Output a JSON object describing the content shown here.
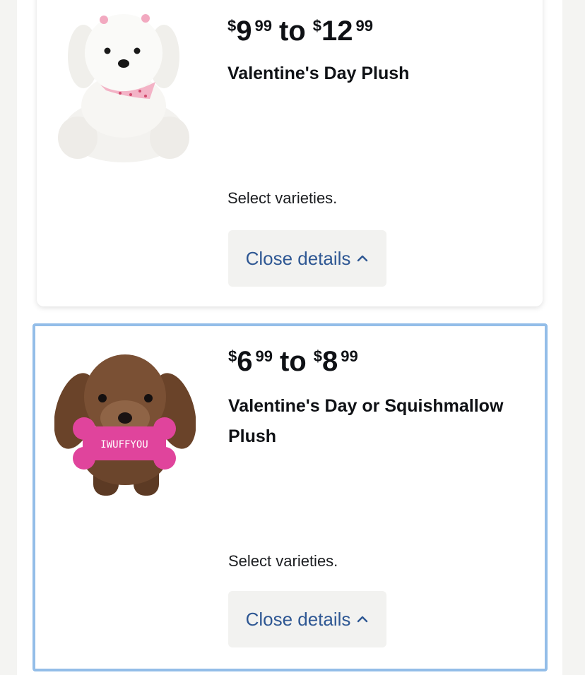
{
  "products": [
    {
      "price": {
        "from_currency": "$",
        "from_dollars": "9",
        "from_cents": "99",
        "to_word": "to",
        "to_currency": "$",
        "to_dollars": "12",
        "to_cents": "99"
      },
      "title": "Valentine's Day Plush",
      "varieties_text": "Select varieties.",
      "details_button_label": "Close details",
      "image": "white-plush-puppy"
    },
    {
      "price": {
        "from_currency": "$",
        "from_dollars": "6",
        "from_cents": "99",
        "to_word": "to",
        "to_currency": "$",
        "to_dollars": "8",
        "to_cents": "99"
      },
      "title": "Valentine's Day or Squishmallow Plush",
      "varieties_text": "Select varieties.",
      "details_button_label": "Close details",
      "image": "brown-plush-puppy-with-pink-bone",
      "bone_text": "IWUFFYOU"
    }
  ],
  "colors": {
    "link": "#2e5793",
    "selected_border": "#93bde8",
    "button_bg": "#f2f2f0",
    "text": "#0f1115",
    "plush_pink": "#e0449c"
  }
}
